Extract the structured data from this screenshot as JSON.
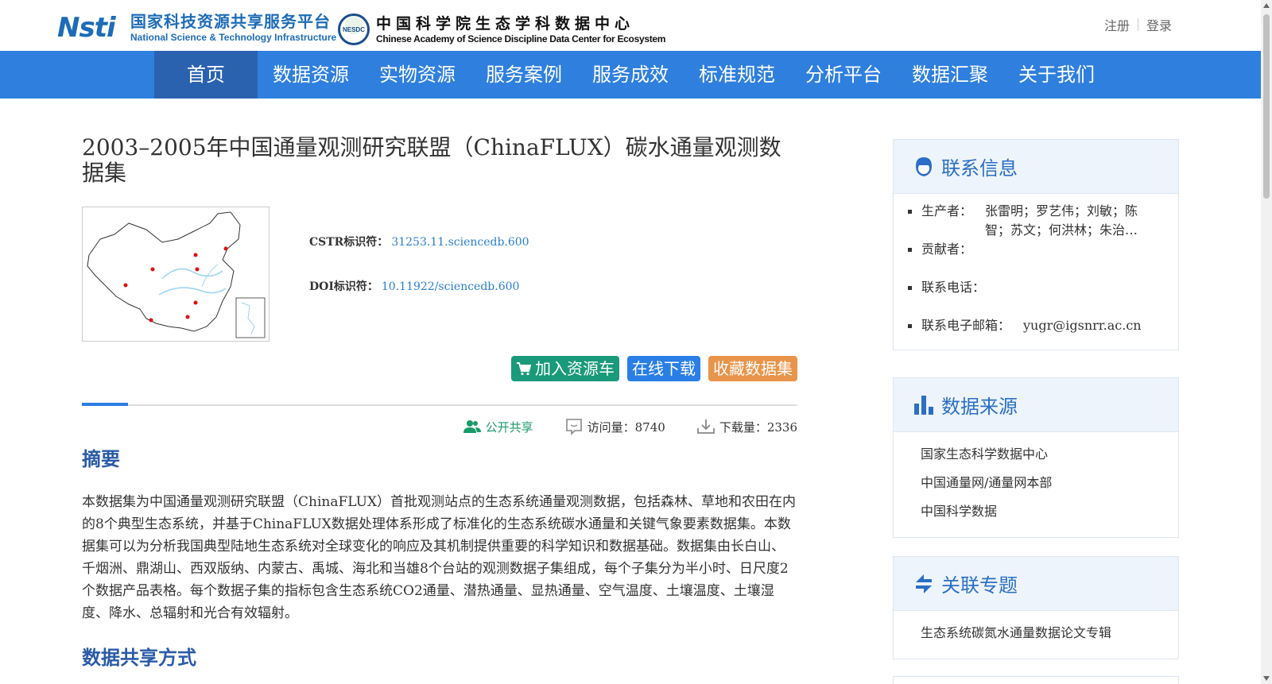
{
  "header": {
    "nsti_cn": "国家科技资源共享服务平台",
    "nsti_en": "National Science & Technology Infrastructure",
    "nsti_mark": "Nsti",
    "nesdc_mark": "NESDC",
    "nesdc_cn": "中国科学院生态学科数据中心",
    "nesdc_en": "Chinese Academy of Science Discipline Data Center for Ecosystem",
    "register": "注册",
    "login": "登录"
  },
  "nav": {
    "items": [
      "首页",
      "数据资源",
      "实物资源",
      "服务案例",
      "服务成效",
      "标准规范",
      "分析平台",
      "数据汇聚",
      "关于我们"
    ]
  },
  "dataset": {
    "title": "2003–2005年中国通量观测研究联盟（ChinaFLUX）碳水通量观测数据集",
    "cstr_label": "CSTR标识符：",
    "cstr_value": "31253.11.sciencedb.600",
    "doi_label": "DOI标识符：",
    "doi_value": "10.11922/sciencedb.600",
    "btn_cart": "加入资源车",
    "btn_download": "在线下载",
    "btn_favorite": "收藏数据集",
    "share_label": "公开共享",
    "visits_label": "访问量：8740",
    "downloads_label": "下载量：2336",
    "abstract_heading": "摘要",
    "abstract_text": "本数据集为中国通量观测研究联盟（ChinaFLUX）首批观测站点的生态系统通量观测数据，包括森林、草地和农田在内的8个典型生态系统，并基于ChinaFLUX数据处理体系形成了标准化的生态系统碳水通量和关键气象要素数据集。本数据集可以为分析我国典型陆地生态系统对全球变化的响应及其机制提供重要的科学知识和数据基础。数据集由长白山、千烟洲、鼎湖山、西双版纳、内蒙古、禹城、海北和当雄8个台站的观测数据子集组成，每个子集分为半小时、日尺度2个数据产品表格。每个数据子集的指标包含生态系统CO2通量、潜热通量、显热通量、空气温度、土壤温度、土壤湿度、降水、总辐射和光合有效辐射。",
    "sharing_heading": "数据共享方式"
  },
  "sidebar": {
    "contact": {
      "title": "联系信息",
      "producer_label": "生产者：",
      "producer_value": "张雷明；罗艺伟；刘敏；陈智；苏文；何洪林；朱治…",
      "contributor_label": "贡献者：",
      "phone_label": "联系电话：",
      "email_label": "联系电子邮箱：",
      "email_value": "yugr@igsnrr.ac.cn"
    },
    "sources": {
      "title": "数据来源",
      "items": [
        "国家生态科学数据中心",
        "中国通量网/通量网本部",
        "中国科学数据"
      ]
    },
    "topics": {
      "title": "关联专题",
      "items": [
        "生态系统碳氮水通量数据论文专辑"
      ]
    }
  },
  "colors": {
    "nav_bg": "#2f7fde",
    "nav_active": "#2a62b0",
    "cart_btn": "#199a7a",
    "download_btn": "#2a7ee6",
    "fav_btn": "#e8944a",
    "heading": "#2a5aa8"
  }
}
